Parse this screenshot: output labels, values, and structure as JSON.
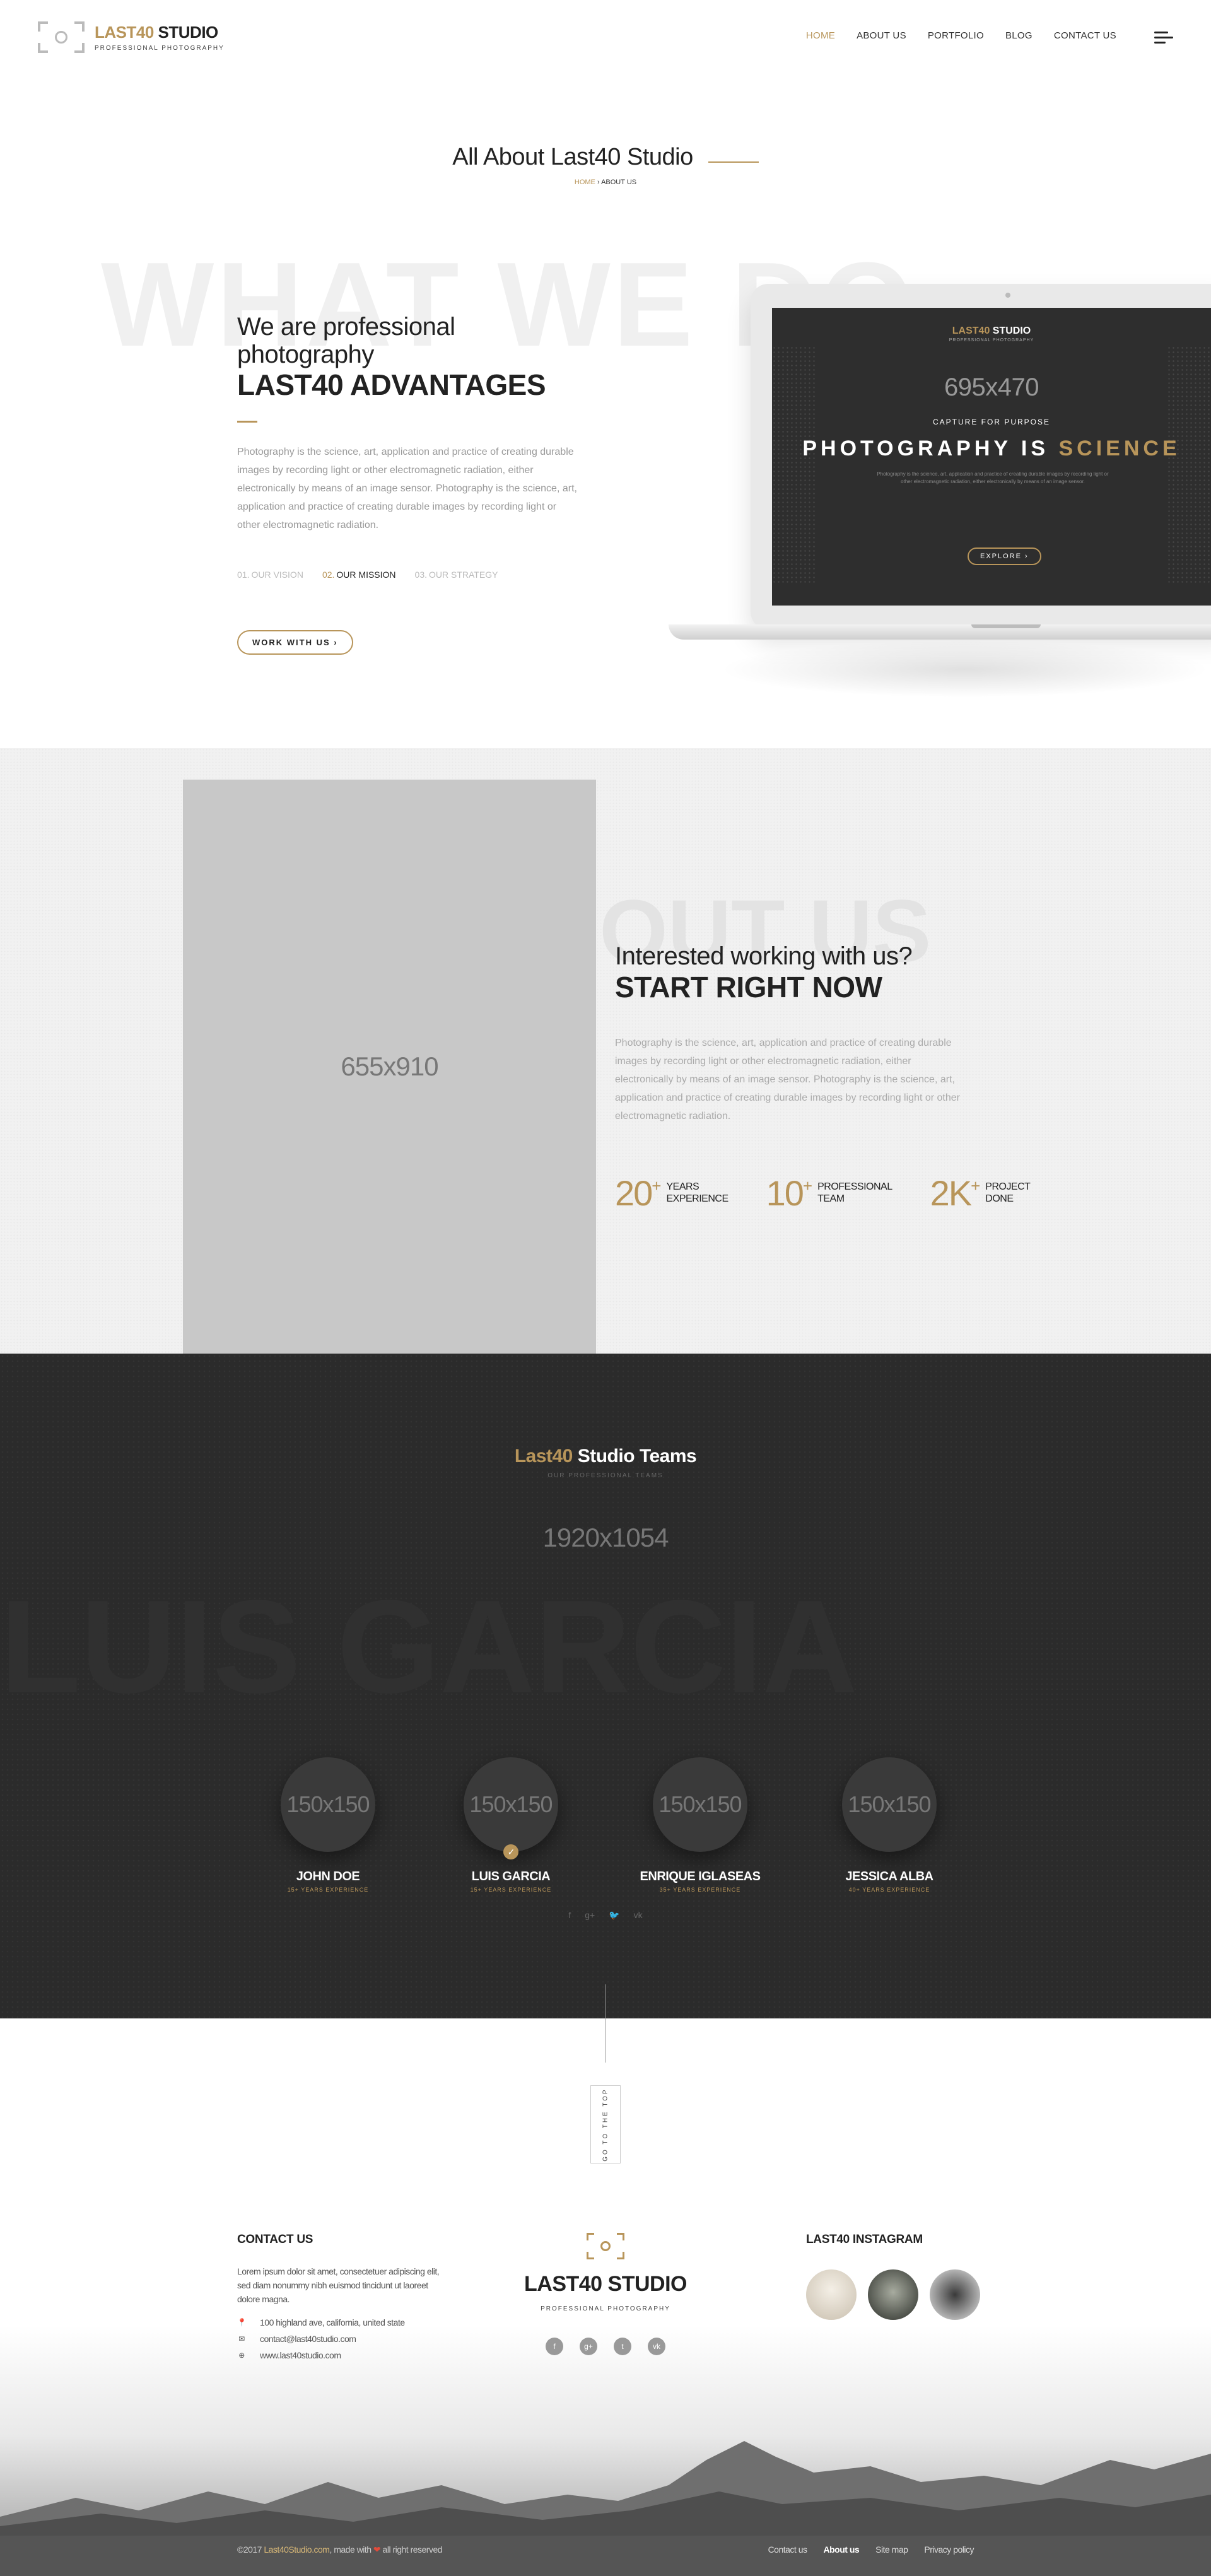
{
  "header": {
    "logo_name_a": "LAST40",
    "logo_name_b": " STUDIO",
    "logo_sub": "PROFESSIONAL PHOTOGRAPHY",
    "nav": [
      "HOME",
      "ABOUT US",
      "PORTFOLIO",
      "BLOG",
      "CONTACT US"
    ],
    "active_nav": "HOME"
  },
  "page_title": {
    "title": "All About Last40 Studio",
    "crumb_home": "HOME",
    "crumb_sep": "›",
    "crumb_current": "ABOUT US"
  },
  "advantages": {
    "bg_word": "WHAT WE DO",
    "heading": "We are professional photography",
    "subheading": "LAST40 ADVANTAGES",
    "body": "Photography is the science, art, application and practice of creating durable images by recording light or other electromagnetic radiation, either electronically by means of an image sensor. Photography is the science, art, application and practice of creating durable images by recording light or other electromagnetic radiation.",
    "tabs": [
      {
        "num": "01.",
        "label": "OUR VISION"
      },
      {
        "num": "02.",
        "label": "OUR MISSION"
      },
      {
        "num": "03.",
        "label": "OUR STRATEGY"
      }
    ],
    "active_tab": "OUR MISSION",
    "button": "WORK WITH US  ›"
  },
  "laptop_screen": {
    "logo_a": "LAST40",
    "logo_b": " STUDIO",
    "logo_sub": "PROFESSIONAL PHOTOGRAPHY",
    "dimension": "695x470",
    "caption": "CAPTURE FOR PURPOSE",
    "headline_a": "PHOTOGRAPHY IS ",
    "headline_b": "SCIENCE",
    "text": "Photography is the science, art, application and practice of creating durable images by recording light or other electromagnetic radiation, either electronically by means of an image sensor.",
    "button": "EXPLORE  ›"
  },
  "about": {
    "photo_dim": "655x910",
    "bg_word": "OUT US",
    "heading": "Interested working with us?",
    "subheading": "START RIGHT NOW",
    "body": "Photography is the science, art, application and practice of creating durable images by recording light or other electromagnetic radiation, either electronically by means of an image sensor. Photography is the science, art, application and practice of creating durable images by recording light or other electromagnetic radiation.",
    "stats": [
      {
        "value": "20",
        "suffix": "+",
        "line1": "YEARS",
        "line2": "EXPERIENCE"
      },
      {
        "value": "10",
        "suffix": "+",
        "line1": "PROFESSIONAL",
        "line2": "TEAM"
      },
      {
        "value": "2K",
        "suffix": "+",
        "line1": "PROJECT",
        "line2": "DONE"
      }
    ]
  },
  "team": {
    "title_a": "Last40",
    "title_b": " Studio Teams",
    "subtitle": "OUR PROFESSIONAL TEAMS",
    "image_dim": "1920x1054",
    "bg_word": "LUIS GARCIA",
    "members": [
      {
        "avatar": "150x150",
        "name": "JOHN DOE",
        "years": "15+ YEARS EXPERIENCE"
      },
      {
        "avatar": "150x150",
        "name": "LUIS GARCIA",
        "years": "15+ YEARS EXPERIENCE"
      },
      {
        "avatar": "150x150",
        "name": "ENRIQUE IGLASEAS",
        "years": "35+ YEARS EXPERIENCE"
      },
      {
        "avatar": "150x150",
        "name": "JESSICA ALBA",
        "years": "40+ YEARS EXPERIENCE"
      }
    ],
    "selected_member": "LUIS GARCIA",
    "socials": [
      "f",
      "g+",
      "twitter-icon",
      "vk"
    ]
  },
  "go_top": "GO TO THE TOP",
  "footer": {
    "contact_title": "CONTACT US",
    "contact_text": "Lorem ipsum dolor sit amet, consectetuer adipiscing elit, sed diam nonummy nibh euismod tincidunt ut laoreet dolore magna.",
    "address": "100 highland ave, california, united state",
    "email": "contact@last40studio.com",
    "website": "www.last40studio.com",
    "logo_name": "LAST40 STUDIO",
    "logo_sub": "PROFESSIONAL PHOTOGRAPHY",
    "social": [
      "f",
      "g+",
      "t",
      "vk"
    ],
    "instagram_title": "LAST40 INSTAGRAM",
    "copyright_a": "©2017 ",
    "copyright_brand": "Last40Studio.com",
    "copyright_b": ", made with ",
    "copyright_heart": "❤",
    "copyright_c": " all right reserved",
    "links": [
      "Contact us",
      "About us",
      "Site map",
      "Privacy policy"
    ],
    "active_link": "About us"
  },
  "colors": {
    "accent": "#b8955a",
    "dark": "#2b2b2b",
    "light_bg": "#f1f1f1"
  }
}
